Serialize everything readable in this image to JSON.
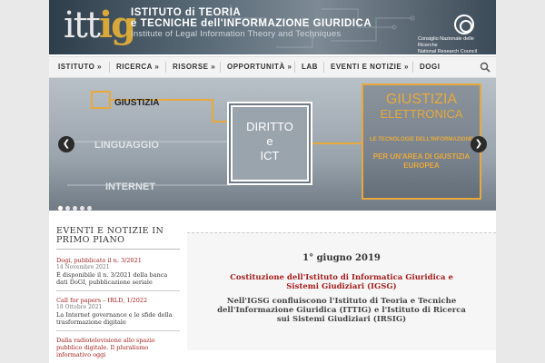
{
  "header": {
    "logo_part1": "itt",
    "logo_part2": "ig",
    "institute_name_line1": "ISTITUTO di TEORIA",
    "institute_name_line2": "e TECNICHE dell'INFORMAZIONE GIURIDICA",
    "institute_name_en": "Institute of Legal Information Theory and Techniques",
    "cnr_text_line1": "Consiglio Nazionale delle Ricerche",
    "cnr_text_line2": "National Research Council"
  },
  "nav": {
    "items": [
      {
        "label": "ISTITUTO »"
      },
      {
        "label": "RICERCA »"
      },
      {
        "label": "RISORSE »"
      },
      {
        "label": "OPPORTUNITÀ »"
      },
      {
        "label": "LAB"
      },
      {
        "label": "EVENTI E NOTIZIE »"
      },
      {
        "label": "DOGI"
      }
    ]
  },
  "slider": {
    "giustizia": "GIUSTIZIA",
    "linguaggio": "LINGUAGGIO",
    "internet": "INTERNET",
    "diritto_line1": "DIRITTO",
    "diritto_line2": "e",
    "diritto_line3": "ICT",
    "ge_line1": "GIUSTIZIA",
    "ge_line2": "ELETTRONICA",
    "ge_sub_line1": "LE TECNOLOGIE DELL'INFORMAZIONE",
    "ge_sub_line2": "PER UN'AREA DI GIUSTIZIA",
    "ge_sub_line3": "EUROPEA",
    "prev": "❮",
    "next": "❯"
  },
  "events": {
    "heading_line1": "EVENTI E NOTIZIE IN",
    "heading_line2": "PRIMO PIANO",
    "items": [
      {
        "title": "Dogi, pubblicato il n. 3/2021",
        "date": "14 Novembre 2021",
        "text": "È disponibile il n. 3/2021 della banca dati DoGI, pubblicazione seriale"
      },
      {
        "title": "Call for papers – IRLD, 1/2022",
        "date": "18 Ottobre 2021",
        "text": "La Internet governance e le sfide della trasformazione digitale"
      },
      {
        "title": "Dalla radiotelevisione allo spazio pubblico digitale. Il pluralismo informativo oggi",
        "date": "",
        "text": ""
      }
    ]
  },
  "news": {
    "date": "1° giugno 2019",
    "title": "Costituzione dell'Istituto di Informatica Giuridica e Sistemi Giudiziari (IGSG)",
    "body": "Nell'IGSG confluiscono l'Istituto di Teoria e Tecniche dell'Informazione Giuridica (ITTIG) e l'Istituto di Ricerca sui Sistemi Giudiziari (IRSIG)"
  }
}
